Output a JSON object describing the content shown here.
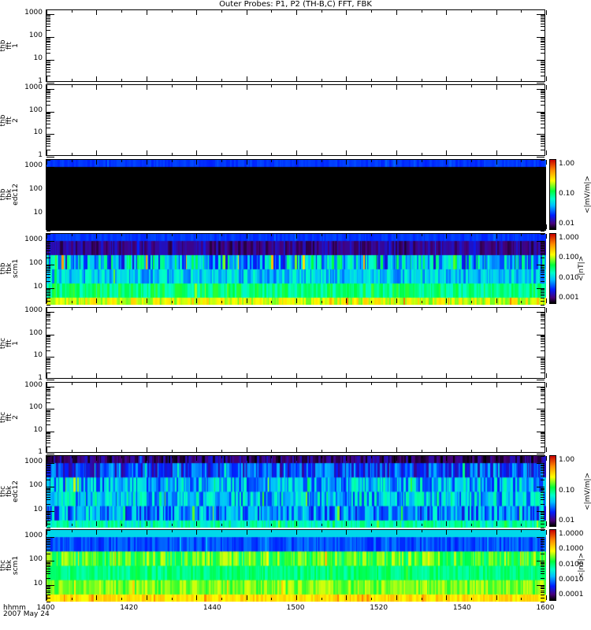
{
  "chart_data": {
    "type": "heatmap",
    "title": "Outer Probes: P1, P2 (TH-B,C) FFT, FBK",
    "x_ticks": [
      "1400",
      "1420",
      "1440",
      "1500",
      "1520",
      "1540",
      "1600"
    ],
    "x_label": "hhmm",
    "date": "2007 May 24",
    "panels": [
      {
        "label": [
          "thb",
          "fft",
          "1"
        ],
        "ylim": [
          1,
          1500
        ],
        "yticks": [
          "1000",
          "100",
          "10",
          "1"
        ],
        "empty": true
      },
      {
        "label": [
          "thb",
          "fft",
          "2"
        ],
        "ylim": [
          1,
          1500
        ],
        "yticks": [
          "1000",
          "100",
          "10",
          "1"
        ],
        "empty": true
      },
      {
        "label": [
          "thb",
          "fbk",
          "edc12"
        ],
        "ylim": [
          2,
          2000
        ],
        "yticks": [
          "1000",
          "100",
          "10"
        ],
        "empty": false,
        "band_levels": [
          0.22,
          0,
          0,
          0,
          0,
          0
        ],
        "band_noise": [
          0.02,
          0,
          0,
          0,
          0,
          0
        ],
        "colorbar": {
          "ticks": [
            "1.00",
            "0.10",
            "0.01"
          ],
          "unit": "<|mV/m|>"
        }
      },
      {
        "label": [
          "thb",
          "fbk",
          "scm1"
        ],
        "ylim": [
          2,
          2000
        ],
        "yticks": [
          "1000",
          "100",
          "10"
        ],
        "empty": false,
        "band_levels": [
          0.22,
          0.1,
          0.35,
          0.36,
          0.5,
          0.68
        ],
        "band_noise": [
          0.02,
          0.06,
          0.2,
          0.1,
          0.08,
          0.08
        ],
        "colorbar": {
          "ticks": [
            "1.000",
            "0.100",
            "0.010",
            "0.001"
          ],
          "unit": "<|nT|>"
        }
      },
      {
        "label": [
          "thc",
          "fft",
          "1"
        ],
        "ylim": [
          1,
          1500
        ],
        "yticks": [
          "1000",
          "100",
          "10",
          "1"
        ],
        "empty": true
      },
      {
        "label": [
          "thc",
          "fft",
          "2"
        ],
        "ylim": [
          1,
          1500
        ],
        "yticks": [
          "1000",
          "100",
          "10",
          "1"
        ],
        "empty": true
      },
      {
        "label": [
          "thc",
          "fbk",
          "edc12"
        ],
        "ylim": [
          2,
          2000
        ],
        "yticks": [
          "1000",
          "100",
          "10"
        ],
        "empty": false,
        "band_levels": [
          0.08,
          0.22,
          0.33,
          0.35,
          0.3,
          0.45
        ],
        "band_noise": [
          0.08,
          0.12,
          0.14,
          0.14,
          0.14,
          0.08
        ],
        "colorbar": {
          "ticks": [
            "1.00",
            "0.10",
            "0.01"
          ],
          "unit": "<|mV/m|>"
        }
      },
      {
        "label": [
          "thc",
          "fbk",
          "scm1"
        ],
        "ylim": [
          2,
          2000
        ],
        "yticks": [
          "1000",
          "100",
          "10"
        ],
        "empty": false,
        "band_levels": [
          0.38,
          0.24,
          0.58,
          0.5,
          0.62,
          0.74
        ],
        "band_noise": [
          0.0,
          0.05,
          0.1,
          0.05,
          0.06,
          0.05
        ],
        "colorbar": {
          "ticks": [
            "1.0000",
            "0.1000",
            "0.0100",
            "0.0010",
            "0.0001"
          ],
          "unit": "<|nT|>"
        }
      }
    ]
  }
}
